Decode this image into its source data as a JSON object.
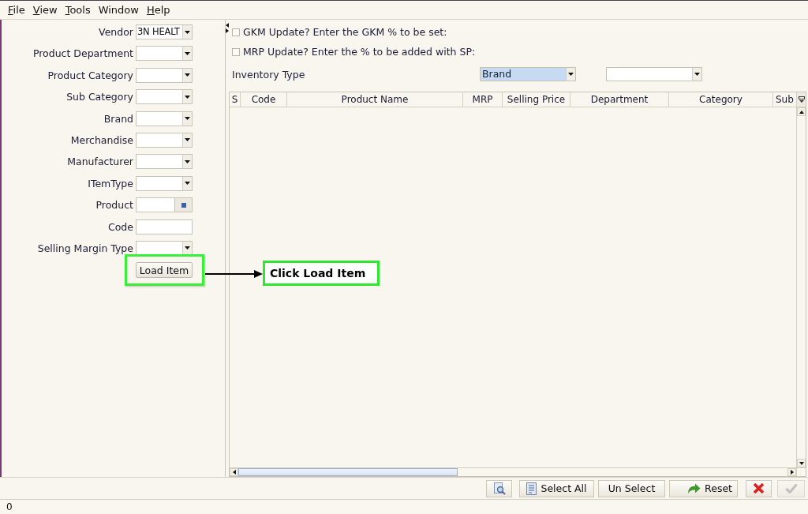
{
  "menu": [
    {
      "label": "File",
      "mnemonic": true
    },
    {
      "label": "View",
      "mnemonic": true
    },
    {
      "label": "Tools",
      "mnemonic": true
    },
    {
      "label": "Window",
      "mnemonic": false
    },
    {
      "label": "Help",
      "mnemonic": true
    }
  ],
  "filters": [
    {
      "label": "Vendor",
      "kind": "combo",
      "value": "3N HEALT"
    },
    {
      "label": "Product Department",
      "kind": "combo"
    },
    {
      "label": "Product Category",
      "kind": "combo"
    },
    {
      "label": "Sub Category",
      "kind": "combo"
    },
    {
      "label": "Brand",
      "kind": "combo"
    },
    {
      "label": "Merchandise",
      "kind": "combo"
    },
    {
      "label": "Manufacturer",
      "kind": "combo"
    },
    {
      "label": "ITemType",
      "kind": "combo"
    },
    {
      "label": "Product",
      "kind": "lookup"
    },
    {
      "label": "Code",
      "kind": "text"
    },
    {
      "label": "Selling Margin Type",
      "kind": "combo"
    }
  ],
  "load_button": "Load Item",
  "annotation": {
    "text": "Click Load Item"
  },
  "options": [
    {
      "label": "GKM Update? Enter the GKM % to be set:",
      "checked": false
    },
    {
      "label": "MRP Update? Enter the % to be added with SP:",
      "checked": false
    }
  ],
  "inventory_type": {
    "label": "Inventory Type",
    "combos": [
      {
        "value": "Brand",
        "focused": true
      },
      {
        "focused": false
      }
    ]
  },
  "table": {
    "columns": [
      "S",
      "Code",
      "Product Name",
      "MRP",
      "Selling Price",
      "Department",
      "Category",
      "Sub"
    ]
  },
  "toolbar": [
    {
      "kind": "preview",
      "disabled": false
    },
    {
      "kind": "select-all",
      "label": "Select All",
      "disabled": false
    },
    {
      "kind": "unselect",
      "label": "Un Select",
      "disabled": false
    },
    {
      "kind": "reset",
      "label": "Reset",
      "disabled": false
    },
    {
      "kind": "cancel",
      "disabled": false
    },
    {
      "kind": "confirm",
      "disabled": true
    }
  ],
  "status_bar": {
    "text": "0"
  }
}
